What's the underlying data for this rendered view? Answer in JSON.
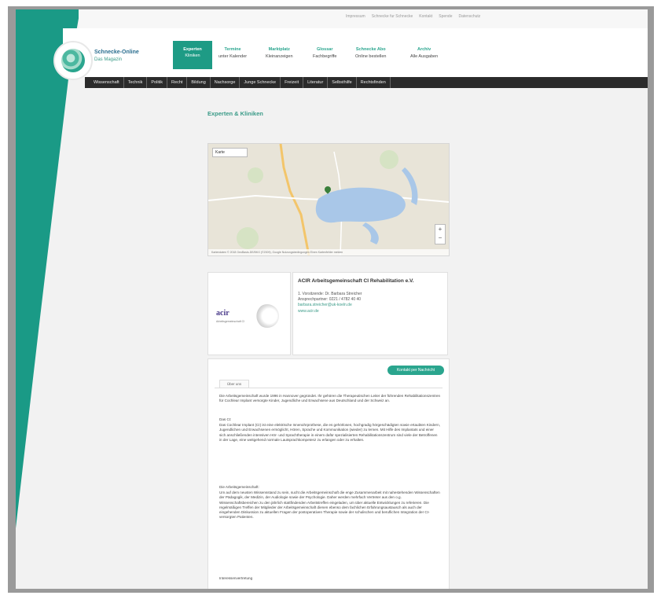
{
  "top_links": [
    "Impressum",
    "Schnecke fur Schnecke",
    "Kontakt",
    "Spende",
    "Datenschutz"
  ],
  "brand": {
    "title": "Schnecke-Online",
    "subtitle": "Das Magazin"
  },
  "nav": [
    {
      "top": "Experten",
      "bottom": "Kliniken",
      "active": true
    },
    {
      "top": "Termine",
      "bottom": "unter Kalender",
      "active": false
    },
    {
      "top": "Marktplatz",
      "bottom": "Kleinanzeigen",
      "active": false
    },
    {
      "top": "Glossar",
      "bottom": "Fachbegriffe",
      "active": false
    },
    {
      "top": "Schnecke Abo",
      "bottom": "Online bestellen",
      "active": false
    },
    {
      "top": "Archiv",
      "bottom": "Alle Ausgaben",
      "active": false
    }
  ],
  "categories": [
    "Wissenschaft",
    "Technik",
    "Politik",
    "Recht",
    "Bildung",
    "Nachsorge",
    "Junge Schnecke",
    "Freizeit",
    "Literatur",
    "Selbsthilfe",
    "Rechtsfinden"
  ],
  "page_heading": "Experten & Kliniken",
  "map": {
    "type_control": "Karte",
    "zoom_in": "+",
    "zoom_out": "−",
    "footer": "Kartendaten © 2018 GeoBasis-DE/BKG (©2009), Google   Nutzungsbedingungen   Einen Kartenfehler melden"
  },
  "org": {
    "logo_text": "acir",
    "logo_sub": "Arbeitsgemeinschaft CI",
    "name": "ACIR Arbeitsgemeinschaft CI Rehabilitation e.V.",
    "line1": "1. Vorsitzende: Dr. Barbara Streicher",
    "line2": "Ansprechpartner: 0221 / 4782 40 40",
    "email": "barbara.streicher@uk-koeln.de",
    "website": "www.acir.de"
  },
  "contact_button": "Kontakt per Nachricht",
  "tab_label": "Über uns",
  "text": {
    "p1": "Die Arbeitsgemeinschaft wurde 1996 in Hannover gegründet. Ihr gehören die Therapeutischen Leiter der führenden Rehabilitationszentren für Cochlear Implant versorgte Kinder, Jugendliche und Erwachsene aus Deutschland und der Schweiz an.",
    "h2": "Das CI:",
    "p2": "Das Cochlear Implant (CI) ist eine elektrische Innenohrprothese, die es gehörlosen, hochgradig hörgeschädigten sowie ertaubten Kindern, Jugendlichen und Erwachsenen ermöglicht, Hören, Sprache und Kommunikation (wieder) zu lernen. Mit Hilfe des Implantats und einer sich anschließenden intensiven Hör- und Sprachtherapie in einem dafür spezialisierten Rehabilitationszentrum sind viele der Betroffenen in der Lage, eine weitgehend normale Lautsprachkompetenz zu erlangen oder zu erhalten.",
    "h3": "Die Arbeitsgemeinschaft:",
    "p3": "Um auf dem neusten Wissensstand zu sein, sucht die Arbeitsgemeinschaft die enge Zusammenarbeit mit nahestehenden Wissenschaften der Pädagogik, der Medizin, der Audiologie sowie der Psychologie. Daher werden mehrfach Vertreter aus den o.g. Wissenschaftsbereichen zu den jährlich stattfindenden Arbeitstreffen eingeladen, um über aktuelle Entwicklungen zu referieren. Die regelmäßigen Treffen der Mitglieder der Arbeitsgemeinschaft dienen ebenso dem fachlichen Erfahrungsaustausch als auch der eingehenden Diskussion zu aktuellen Fragen der postoperativen Therapie sowie der schulischen und beruflichen Integration der CI-versorgten Patienten.",
    "h4": "Interessenvertretung"
  }
}
